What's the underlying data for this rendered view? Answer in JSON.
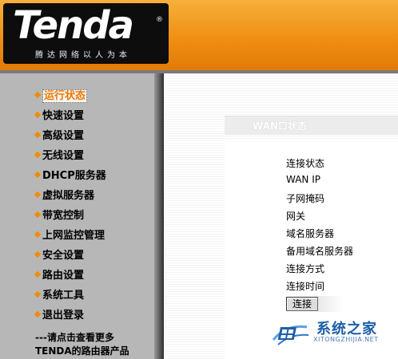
{
  "header": {
    "logo_text": "Tenda",
    "logo_reg": "®",
    "slogan": "腾达网络以人为本"
  },
  "sidebar": {
    "items": [
      {
        "label": "运行状态",
        "active": true
      },
      {
        "label": "快速设置"
      },
      {
        "label": "高级设置"
      },
      {
        "label": "无线设置"
      },
      {
        "label": "DHCP服务器"
      },
      {
        "label": "虚拟服务器"
      },
      {
        "label": "带宽控制"
      },
      {
        "label": "上网监控管理"
      },
      {
        "label": "安全设置"
      },
      {
        "label": "路由设置"
      },
      {
        "label": "系统工具"
      },
      {
        "label": "退出登录"
      }
    ],
    "more_line1": "---请点击查看更多",
    "more_line2": "TENDA的路由器产品"
  },
  "main": {
    "section_title": "WAN口状态",
    "fields": [
      {
        "label": "连接状态"
      },
      {
        "label": "WAN IP"
      },
      {
        "label": "子网掩码"
      },
      {
        "label": "网关"
      },
      {
        "label": "域名服务器"
      },
      {
        "label": "备用域名服务器"
      },
      {
        "label": "连接方式"
      },
      {
        "label": "连接时间"
      }
    ],
    "connect_label": "连接"
  },
  "watermark": {
    "text": "系统之家",
    "sub": "XITONGZHIJIA.NET"
  },
  "colors": {
    "accent": "#f08c00",
    "header_orange": "#f08f13",
    "sidebar_gray": "#b7b7b7",
    "watermark_blue": "#1d5fa8"
  }
}
